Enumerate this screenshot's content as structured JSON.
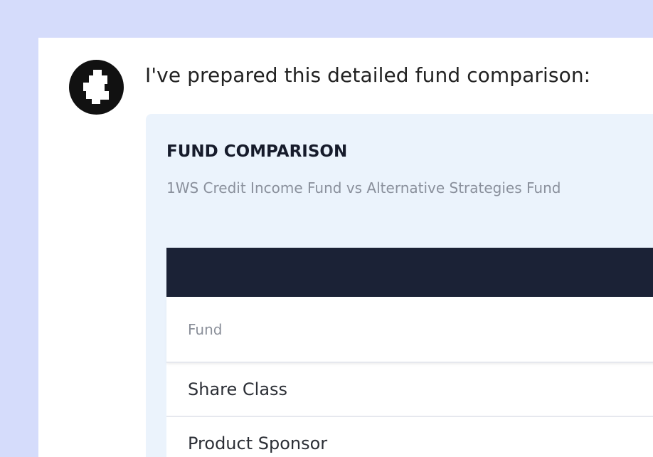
{
  "message": {
    "text": "I've prepared this detailed fund comparison:"
  },
  "avatar": {
    "icon": "assistant-logo-icon"
  },
  "card": {
    "title": "FUND COMPARISON",
    "subtitle": "1WS Credit Income Fund vs Alternative Strategies Fund",
    "table": {
      "rows": [
        {
          "label": "Fund"
        },
        {
          "label": "Share Class"
        },
        {
          "label": "Product Sponsor"
        }
      ]
    }
  },
  "colors": {
    "page_background": "#d5dcfb",
    "card_background": "#ebf3fc",
    "table_header": "#1b2236",
    "avatar": "#111111"
  }
}
